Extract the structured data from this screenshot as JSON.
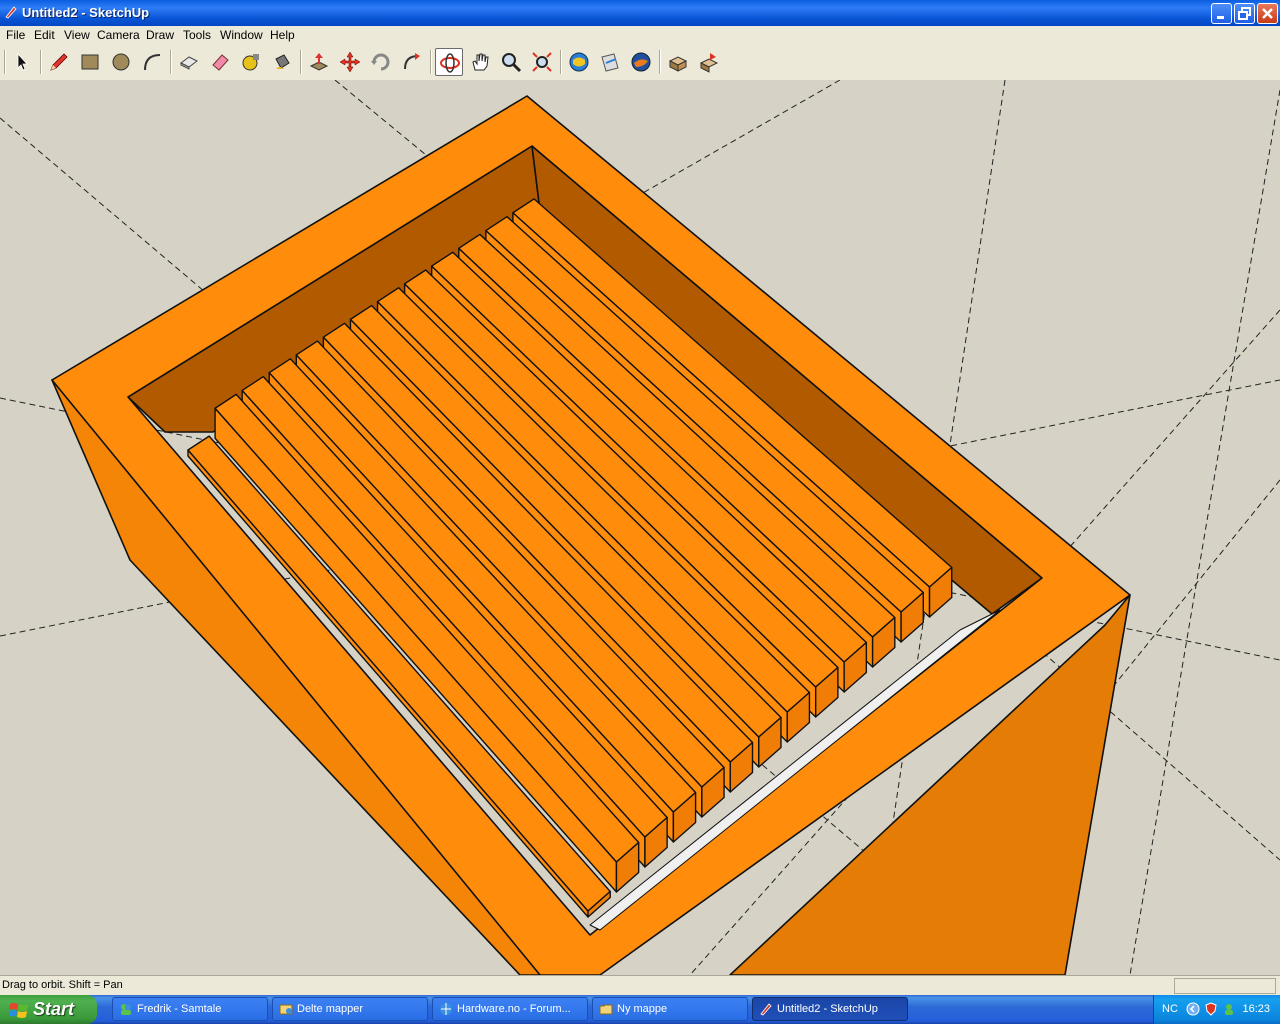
{
  "window": {
    "title": "Untitled2 - SketchUp"
  },
  "menu": [
    "File",
    "Edit",
    "View",
    "Camera",
    "Draw",
    "Tools",
    "Window",
    "Help"
  ],
  "toolbar": {
    "tools": [
      {
        "name": "select-tool-icon"
      },
      {
        "name": "pencil-tool-icon"
      },
      {
        "name": "rectangle-tool-icon"
      },
      {
        "name": "circle-tool-icon"
      },
      {
        "name": "arc-tool-icon"
      },
      {
        "name": "make-component-icon"
      },
      {
        "name": "eraser-tool-icon"
      },
      {
        "name": "tape-measure-icon"
      },
      {
        "name": "paint-bucket-icon"
      },
      {
        "name": "push-pull-icon"
      },
      {
        "name": "move-tool-icon"
      },
      {
        "name": "rotate-tool-icon"
      },
      {
        "name": "follow-me-icon"
      },
      {
        "name": "orbit-tool-icon"
      },
      {
        "name": "pan-tool-icon"
      },
      {
        "name": "zoom-tool-icon"
      },
      {
        "name": "zoom-extents-icon"
      },
      {
        "name": "get-models-icon"
      },
      {
        "name": "share-model-icon"
      },
      {
        "name": "google-earth-icon"
      },
      {
        "name": "component-window-icon"
      },
      {
        "name": "share-component-icon"
      }
    ],
    "active_tool": "orbit-tool-icon"
  },
  "model": {
    "color": "#ff8c0a",
    "shadow_color": "#b05a00",
    "background": "#d6d3c6"
  },
  "status": {
    "text": "Drag to orbit.  Shift = Pan"
  },
  "taskbar": {
    "start_label": "Start",
    "tasks": [
      {
        "label": "Fredrik - Samtale",
        "active": false
      },
      {
        "label": "Delte mapper",
        "active": false
      },
      {
        "label": "Hardware.no - Forum...",
        "active": false
      },
      {
        "label": "Ny mappe",
        "active": false
      },
      {
        "label": "Untitled2 - SketchUp",
        "active": true
      }
    ],
    "tray": {
      "language": "NC",
      "clock": "16:23"
    }
  }
}
